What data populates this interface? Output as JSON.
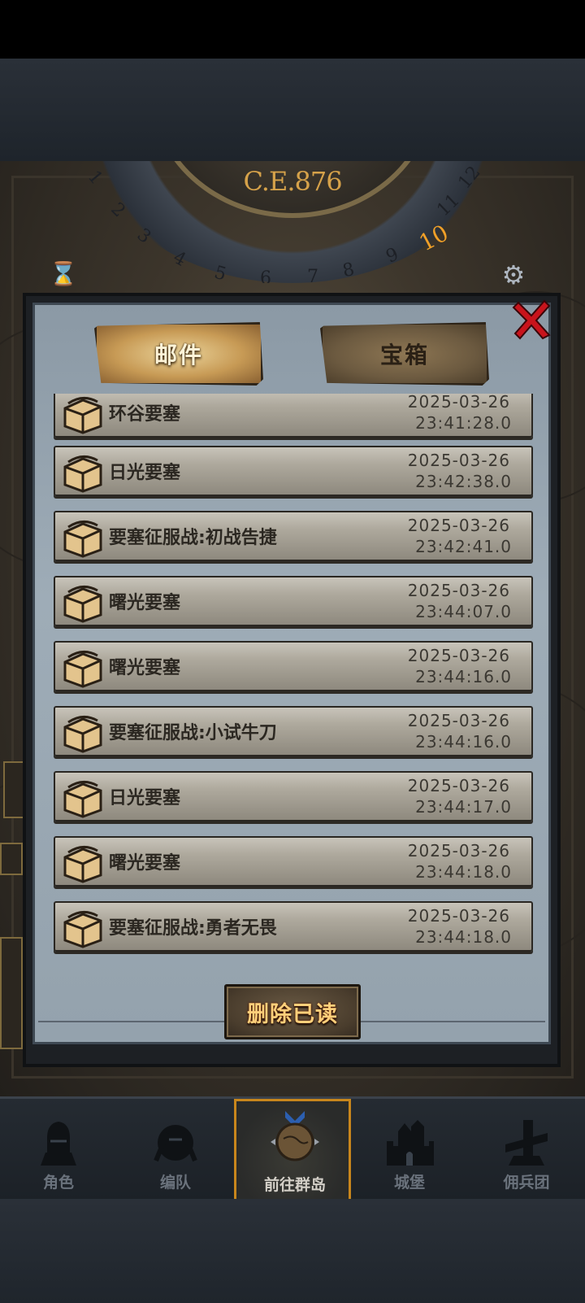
{
  "calendar": {
    "year_label": "C.E.876",
    "current_month": "10",
    "months": [
      "1",
      "2",
      "3",
      "4",
      "5",
      "6",
      "7",
      "8",
      "9",
      "10",
      "11",
      "12"
    ]
  },
  "tabs": [
    {
      "label": "邮件",
      "selected": true
    },
    {
      "label": "宝箱",
      "selected": false
    }
  ],
  "mail_list": [
    {
      "title": "环谷要塞",
      "date": "2025-03-26",
      "time": "23:41:28.0"
    },
    {
      "title": "日光要塞",
      "date": "2025-03-26",
      "time": "23:42:38.0"
    },
    {
      "title": "要塞征服战:初战告捷",
      "date": "2025-03-26",
      "time": "23:42:41.0"
    },
    {
      "title": "曙光要塞",
      "date": "2025-03-26",
      "time": "23:44:07.0"
    },
    {
      "title": "曙光要塞",
      "date": "2025-03-26",
      "time": "23:44:16.0"
    },
    {
      "title": "要塞征服战:小试牛刀",
      "date": "2025-03-26",
      "time": "23:44:16.0"
    },
    {
      "title": "日光要塞",
      "date": "2025-03-26",
      "time": "23:44:17.0"
    },
    {
      "title": "曙光要塞",
      "date": "2025-03-26",
      "time": "23:44:18.0"
    },
    {
      "title": "要塞征服战:勇者无畏",
      "date": "2025-03-26",
      "time": "23:44:18.0"
    }
  ],
  "delete_read_label": "删除已读",
  "bottom_nav": [
    {
      "label": "角色",
      "icon": "knight-helmet-icon",
      "active": false
    },
    {
      "label": "编队",
      "icon": "party-formation-icon",
      "active": false
    },
    {
      "label": "前往群岛",
      "icon": "globe-compass-icon",
      "active": true
    },
    {
      "label": "城堡",
      "icon": "castle-icon",
      "active": false
    },
    {
      "label": "佣兵团",
      "icon": "mercenary-banner-icon",
      "active": false
    }
  ],
  "colors": {
    "accent_gold": "#d6a24a",
    "close_red": "#c8141c",
    "active_nav_border": "#c8861c"
  }
}
